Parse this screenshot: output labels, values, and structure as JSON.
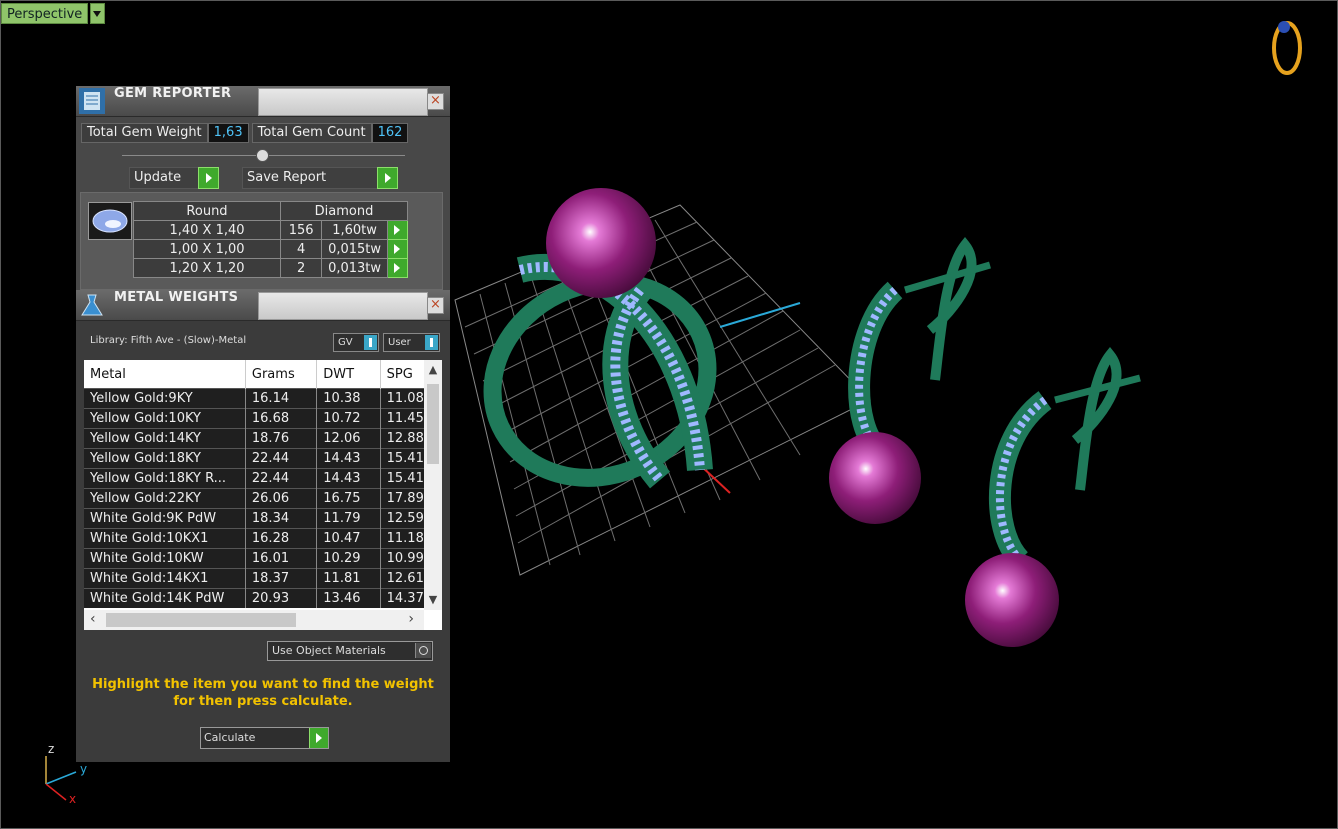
{
  "viewport": {
    "mode": "Perspective"
  },
  "gem_reporter": {
    "title": "GEM REPORTER",
    "total_weight_label": "Total Gem Weight",
    "total_weight_value": "1,63",
    "total_count_label": "Total Gem Count",
    "total_count_value": "162",
    "update_label": "Update",
    "save_label": "Save Report",
    "shape": "Round",
    "material": "Diamond",
    "rows": [
      {
        "size": "1,40 X 1,40",
        "count": "156",
        "weight": "1,60tw"
      },
      {
        "size": "1,00 X 1,00",
        "count": "4",
        "weight": "0,015tw"
      },
      {
        "size": "1,20 X 1,20",
        "count": "2",
        "weight": "0,013tw"
      }
    ]
  },
  "metal_weights": {
    "title": "METAL WEIGHTS",
    "library": "Library: Fifth Ave - (Slow)-Metal",
    "toggle_gv": "GV",
    "toggle_user": "User",
    "columns": [
      "Metal",
      "Grams",
      "DWT",
      "SPG"
    ],
    "rows": [
      [
        "Yellow Gold:9KY",
        "16.14",
        "10.38",
        "11.08"
      ],
      [
        "Yellow Gold:10KY",
        "16.68",
        "10.72",
        "11.45"
      ],
      [
        "Yellow Gold:14KY",
        "18.76",
        "12.06",
        "12.88"
      ],
      [
        "Yellow Gold:18KY",
        "22.44",
        "14.43",
        "15.41"
      ],
      [
        "Yellow Gold:18KY R...",
        "22.44",
        "14.43",
        "15.41"
      ],
      [
        "Yellow Gold:22KY",
        "26.06",
        "16.75",
        "17.89"
      ],
      [
        "White Gold:9K PdW",
        "18.34",
        "11.79",
        "12.59"
      ],
      [
        "White Gold:10KX1",
        "16.28",
        "10.47",
        "11.18"
      ],
      [
        "White Gold:10KW",
        "16.01",
        "10.29",
        "10.99"
      ],
      [
        "White Gold:14KX1",
        "18.37",
        "11.81",
        "12.61"
      ],
      [
        "White Gold:14K PdW",
        "20.93",
        "13.46",
        "14.37"
      ]
    ],
    "use_object_materials": "Use Object Materials",
    "hint": "Highlight the item you want to find the weight for then press calculate.",
    "calculate_label": "Calculate"
  },
  "axes": {
    "z": "z",
    "y": "y",
    "x": "x"
  },
  "colors": {
    "metal": "#1f7a5a",
    "pearl": "#8e1e78",
    "gems": "#9fb8ff",
    "hint": "#f2c200",
    "go_button": "#3fa92c"
  }
}
